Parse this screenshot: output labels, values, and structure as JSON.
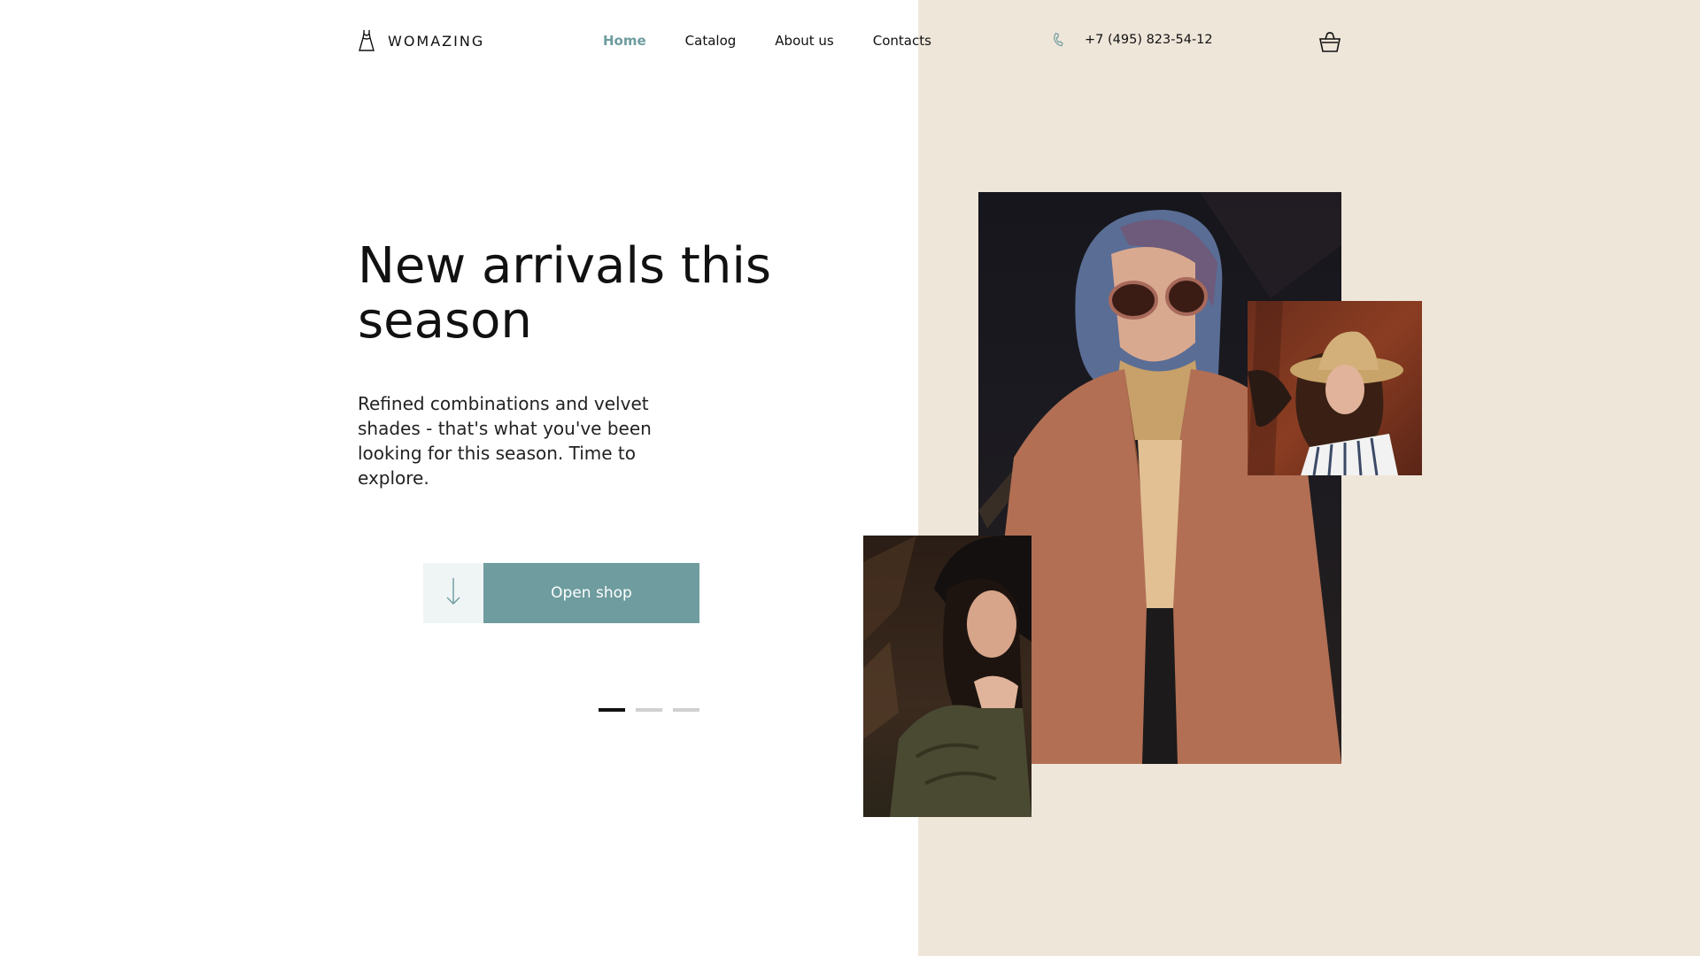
{
  "brand": {
    "name": "WOMAZING",
    "icon": "dress-icon"
  },
  "nav": {
    "items": [
      {
        "label": "Home",
        "active": true
      },
      {
        "label": "Catalog",
        "active": false
      },
      {
        "label": "About us",
        "active": false
      },
      {
        "label": "Contacts",
        "active": false
      }
    ]
  },
  "contact": {
    "phone": "+7 (495) 823-54-12",
    "icon": "phone-icon"
  },
  "cart": {
    "icon": "shopping-basket-icon"
  },
  "hero": {
    "title": "New arrivals this season",
    "subtitle": "Refined combinations and velvet shades - that's what you've been looking for this season. Time to explore.",
    "cta_label": "Open shop",
    "cta_icon": "arrow-down-icon"
  },
  "slider": {
    "count": 3,
    "active_index": 0
  },
  "colors": {
    "accent": "#6e9c9f",
    "accent_light": "#eff4f4",
    "beige_panel": "#efe6da"
  }
}
